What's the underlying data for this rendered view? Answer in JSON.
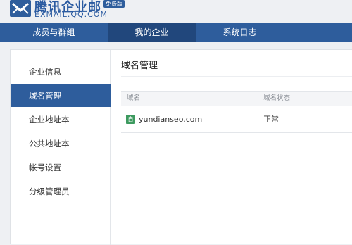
{
  "brand": {
    "name": "腾讯企业邮",
    "url": "EXMAIL.QQ.COM",
    "badge": "免费版"
  },
  "nav": {
    "tabs": [
      {
        "label": "成员与群组",
        "active": false
      },
      {
        "label": "我的企业",
        "active": true
      },
      {
        "label": "系统日志",
        "active": false
      }
    ]
  },
  "sidebar": {
    "items": [
      {
        "label": "企业信息",
        "active": false
      },
      {
        "label": "域名管理",
        "active": true
      },
      {
        "label": "企业地址本",
        "active": false
      },
      {
        "label": "公共地址本",
        "active": false
      },
      {
        "label": "帐号设置",
        "active": false
      },
      {
        "label": "分级管理员",
        "active": false
      }
    ]
  },
  "main": {
    "title": "域名管理",
    "table": {
      "columns": [
        "域名",
        "域名状态"
      ],
      "rows": [
        {
          "icon_text": "自",
          "domain": "yundianseo.com",
          "status": "正常"
        }
      ]
    }
  },
  "colors": {
    "accent": "#2e5d9c",
    "nav_active": "#21477c",
    "domain_icon": "#3d9a5f"
  }
}
